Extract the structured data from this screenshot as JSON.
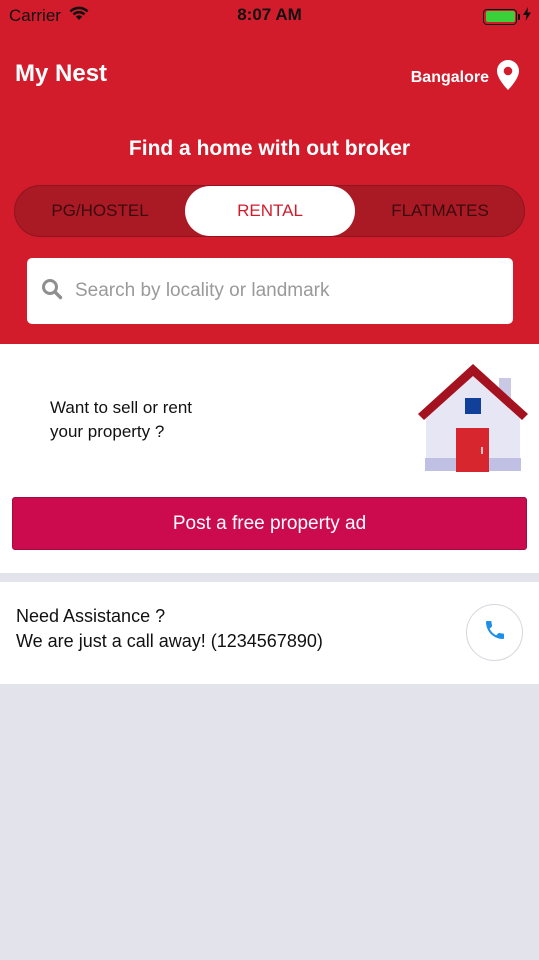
{
  "status_bar": {
    "carrier": "Carrier",
    "time": "8:07 AM"
  },
  "header": {
    "app_title": "My Nest",
    "city": "Bangalore",
    "tagline": "Find a home with out broker"
  },
  "tabs": [
    {
      "label": "PG/HOSTEL",
      "selected": false
    },
    {
      "label": "RENTAL",
      "selected": true
    },
    {
      "label": "FLATMATES",
      "selected": false
    }
  ],
  "search": {
    "placeholder": "Search by locality or landmark",
    "value": ""
  },
  "sell_card": {
    "text_line1": "Want to sell or rent",
    "text_line2": "your property ?",
    "button_label": "Post a free property ad"
  },
  "help_card": {
    "line1": "Need Assistance ?",
    "line2": "We are just a call away! (1234567890)"
  },
  "colors": {
    "brand_red": "#d21c2c",
    "tab_track": "#a91a25",
    "post_button": "#cc0a4e",
    "call_icon": "#1e8fe6",
    "background": "#e3e3ec"
  },
  "icons": [
    "wifi-icon",
    "battery-icon",
    "location-pin-icon",
    "search-icon",
    "house-icon",
    "phone-icon"
  ]
}
